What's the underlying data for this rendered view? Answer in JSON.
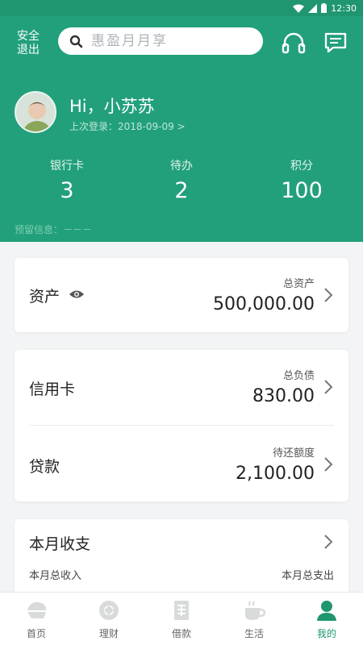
{
  "status_bar": {
    "time": "12:30"
  },
  "header": {
    "logout_label": "安全退出",
    "search_placeholder": "惠盈月月享",
    "greeting": "Hi，小苏苏",
    "last_login": "上次登录：2018-09-09 >",
    "stats": [
      {
        "label": "银行卡",
        "value": "3"
      },
      {
        "label": "待办",
        "value": "2"
      },
      {
        "label": "积分",
        "value": "100"
      }
    ],
    "reserved_info": "预留信息：－－－"
  },
  "assets": {
    "title": "资产",
    "sub_label": "总资产",
    "amount": "500,000.00"
  },
  "credit_card": {
    "title": "信用卡",
    "sub_label": "总负债",
    "amount": "830.00"
  },
  "loan": {
    "title": "贷款",
    "sub_label": "待还额度",
    "amount": "2,100.00"
  },
  "monthly": {
    "title": "本月收支",
    "income_label": "本月总收入",
    "expense_label": "本月总支出"
  },
  "tabbar": {
    "items": [
      {
        "label": "首页",
        "icon": "home-icon"
      },
      {
        "label": "理财",
        "icon": "finance-icon"
      },
      {
        "label": "借款",
        "icon": "loan-icon"
      },
      {
        "label": "生活",
        "icon": "coffee-icon"
      },
      {
        "label": "我的",
        "icon": "person-icon"
      }
    ],
    "active_index": 4
  },
  "colors": {
    "primary": "#22a07c",
    "primary_dark": "#1f9670",
    "tab_inactive": "#d8dadb"
  }
}
